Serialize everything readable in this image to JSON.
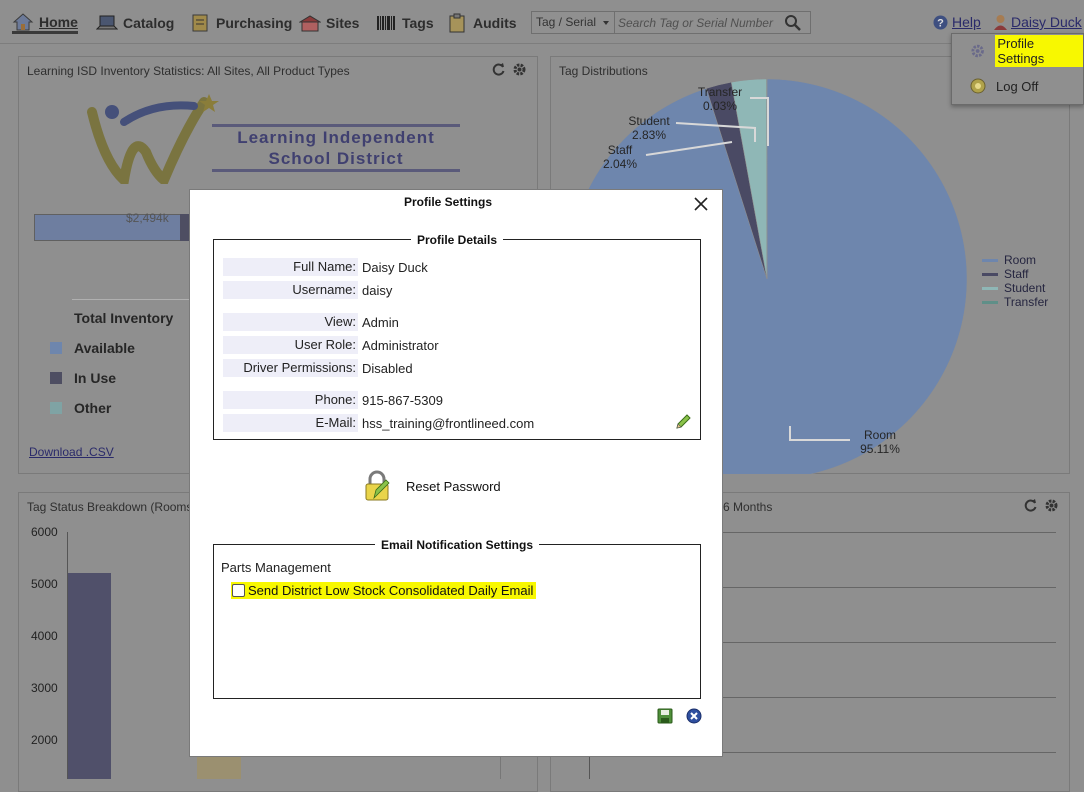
{
  "nav": {
    "home": "Home",
    "catalog": "Catalog",
    "purchasing": "Purchasing",
    "sites": "Sites",
    "tags": "Tags",
    "audits": "Audits"
  },
  "search": {
    "mode": "Tag / Serial",
    "placeholder": "Search Tag or Serial Number"
  },
  "header": {
    "help": "Help",
    "user": "Daisy Duck"
  },
  "user_menu": {
    "profile_settings": "Profile Settings",
    "log_off": "Log Off"
  },
  "stats_panel": {
    "title": "Learning ISD Inventory Statistics: All Sites, All Product Types",
    "logo_line1": "Learning Independent",
    "logo_line2": "School District",
    "bar_value": "$2,494k",
    "legend": {
      "total": "Total Inventory",
      "available": "Available",
      "in_use": "In Use",
      "other": "Other"
    },
    "download": "Download .CSV",
    "colors": {
      "available": "#6e86ad",
      "in_use": "#4e4e62",
      "other": "#7fa3a4"
    }
  },
  "tag_panel": {
    "title": "Tag Distributions",
    "legend": [
      "Room",
      "Staff",
      "Student",
      "Transfer"
    ],
    "labels": {
      "transfer_name": "Transfer",
      "transfer_pct": "0.03%",
      "student_name": "Student",
      "student_pct": "2.83%",
      "staff_name": "Staff",
      "staff_pct": "2.04%",
      "room_name": "Room",
      "room_pct": "95.11%"
    }
  },
  "status_panel": {
    "title": "Tag Status Breakdown (Rooms)",
    "yticks": [
      "6000",
      "5000",
      "4000",
      "3000",
      "2000"
    ]
  },
  "months_panel": {
    "title_fragment": "6 Months"
  },
  "chart_data": [
    {
      "type": "pie",
      "title": "Tag Distributions",
      "categories": [
        "Room",
        "Staff",
        "Student",
        "Transfer"
      ],
      "values": [
        95.11,
        2.04,
        2.83,
        0.03
      ],
      "colors": [
        "#6e86ad",
        "#4a4a64",
        "#8fb7b6",
        "#5f8f88"
      ],
      "legend_position": "right"
    },
    {
      "type": "bar",
      "title": "Tag Status Breakdown (Rooms)",
      "ylim": [
        0,
        6000
      ],
      "yticks": [
        2000,
        3000,
        4000,
        5000,
        6000
      ],
      "values": [
        5220
      ],
      "grid": false
    }
  ],
  "modal": {
    "title": "Profile Settings",
    "details_legend": "Profile Details",
    "fields": [
      {
        "label": "Full Name:",
        "value": "Daisy Duck"
      },
      {
        "label": "Username:",
        "value": "daisy"
      },
      {
        "label": "View:",
        "value": "Admin"
      },
      {
        "label": "User Role:",
        "value": "Administrator"
      },
      {
        "label": "Driver Permissions:",
        "value": "Disabled"
      },
      {
        "label": "Phone:",
        "value": "915-867-5309"
      },
      {
        "label": "E-Mail:",
        "value": "hss_training@frontlineed.com"
      }
    ],
    "reset_password": "Reset Password",
    "notif_legend": "Email Notification Settings",
    "notif_group": "Parts Management",
    "notif_option": "Send District Low Stock Consolidated Daily Email",
    "notif_checked": false
  }
}
